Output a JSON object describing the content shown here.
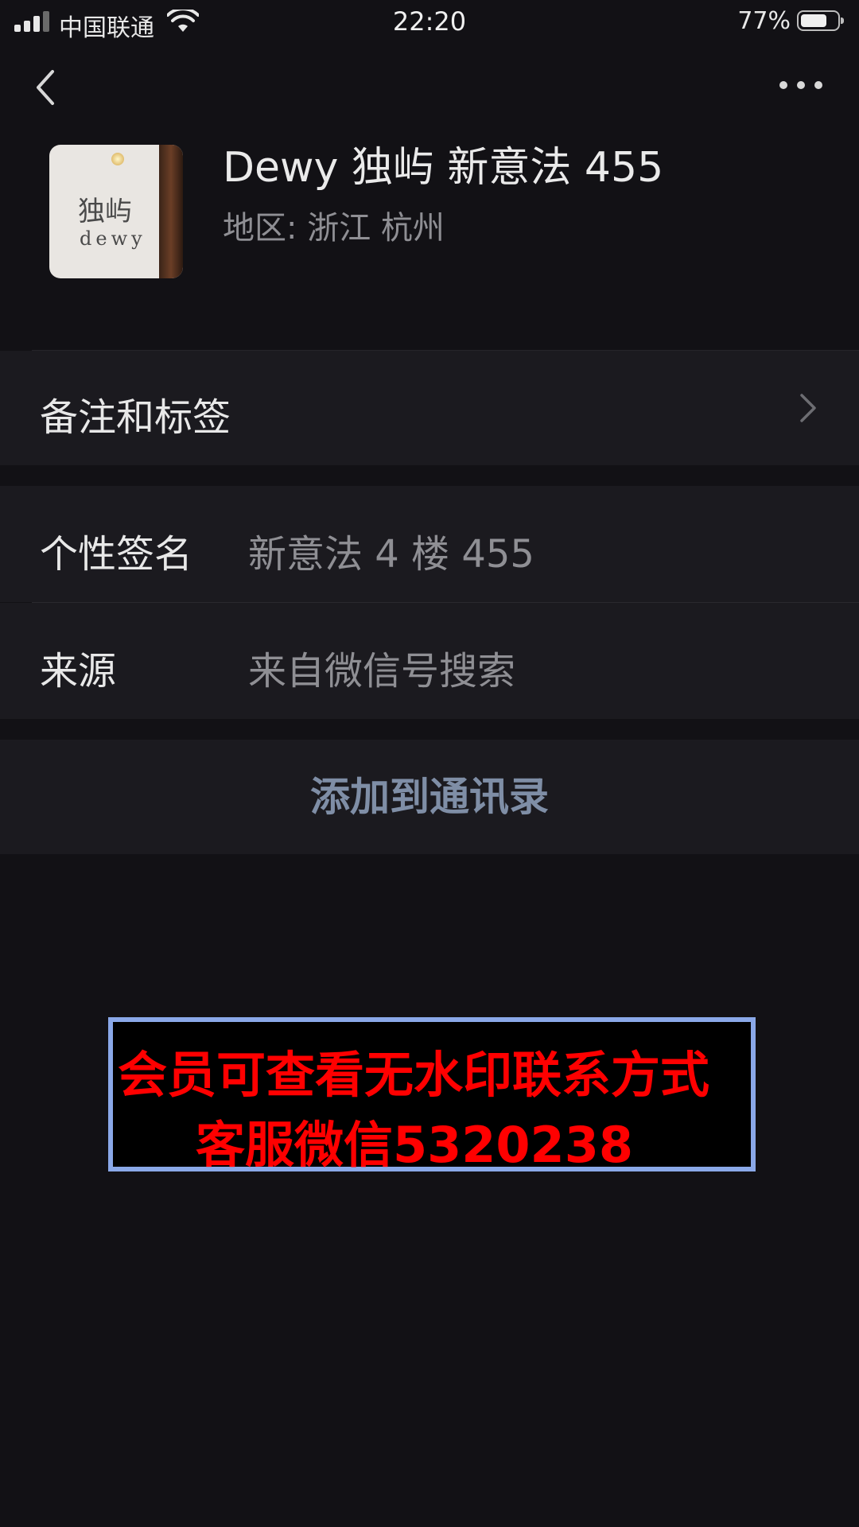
{
  "status_bar": {
    "carrier": "中国联通",
    "time": "22:20",
    "battery_percent": "77%",
    "battery_level": 0.77,
    "icons": [
      "signal-icon",
      "wifi-icon",
      "battery-icon"
    ]
  },
  "nav": {
    "back_icon": "chevron-left-icon",
    "more_icon": "ellipsis-icon"
  },
  "profile": {
    "avatar_text_cn": "独屿",
    "avatar_text_en": "dewy",
    "name": "Dewy 独屿 新意法 455",
    "region": "地区: 浙江 杭州"
  },
  "rows": {
    "remark_tags_label": "备注和标签",
    "signature_label": "个性签名",
    "signature_value": "新意法 4 楼 455",
    "source_label": "来源",
    "source_value": "来自微信号搜索"
  },
  "actions": {
    "add_contact": "添加到通讯录"
  },
  "watermark": {
    "line1": "会员可查看无水印联系方式",
    "line2": "客服微信5320238"
  },
  "colors": {
    "background": "#121115",
    "row_background": "#1b1a1f",
    "add_button_text": "#7f8ea6",
    "watermark_text": "#ff0000",
    "watermark_border": "#8aa8e8"
  }
}
